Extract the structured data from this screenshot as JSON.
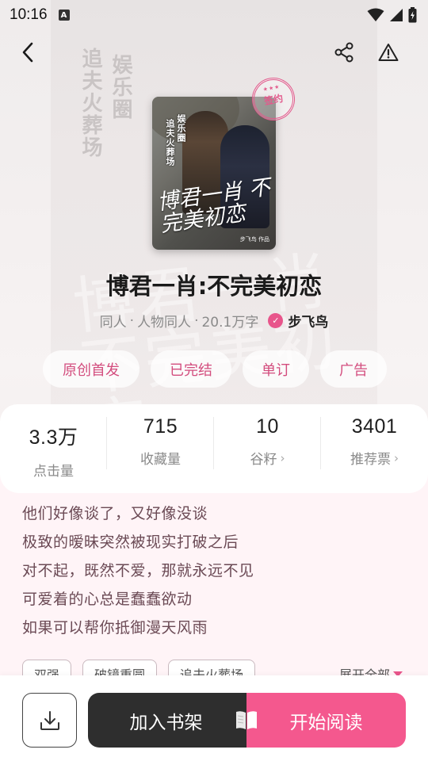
{
  "status_bar": {
    "time": "10:16",
    "notif_letter": "A"
  },
  "cover": {
    "vertical_1": "娱乐圈",
    "vertical_2": "追夫火葬场",
    "title": "博君一肖 不完美初恋",
    "author": "步飞鸟 作品",
    "stamp": "签约"
  },
  "background": {
    "vertical_1": "娱乐圈",
    "vertical_2": "追夫火葬场",
    "title": "博君一肖 不完美初恋"
  },
  "book": {
    "title": "博君一肖:不完美初恋",
    "category": "同人",
    "subcategory": "人物同人",
    "word_count": "20.1万字",
    "sep": "·",
    "author": "步飞鸟"
  },
  "tags": [
    "原创首发",
    "已完结",
    "单订",
    "广告"
  ],
  "stats": [
    {
      "value": "3.3万",
      "label": "点击量",
      "has_chevron": false
    },
    {
      "value": "715",
      "label": "收藏量",
      "has_chevron": false
    },
    {
      "value": "10",
      "label": "谷籽",
      "has_chevron": true
    },
    {
      "value": "3401",
      "label": "推荐票",
      "has_chevron": true
    }
  ],
  "description": [
    "他们好像谈了，又好像没谈",
    "极致的暧昧突然被现实打破之后",
    "对不起，既然不爱，那就永远不见",
    "可爱着的心总是蠢蠢欲动",
    "如果可以帮你抵御漫天风雨"
  ],
  "desc_tags": [
    "双强",
    "破镜重圆",
    "追夫火葬场"
  ],
  "expand_label": "展开全部",
  "actions": {
    "add_shelf": "加入书架",
    "start_read": "开始阅读"
  },
  "colors": {
    "accent": "#f4588e",
    "dark_button": "#2e2e2e",
    "tag_text": "#d34d7e",
    "desc_bg": "#fff4f7"
  }
}
